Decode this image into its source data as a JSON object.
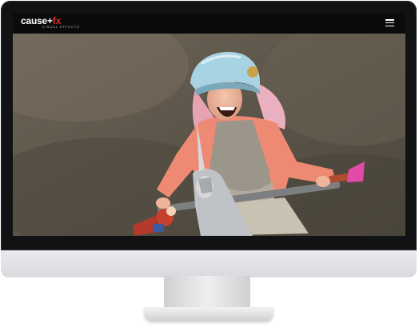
{
  "navbar": {
    "logo_main": "cause+",
    "logo_fx": "fx",
    "logo_sub": "VISUAL EFFECTS",
    "menu_icon": "hamburger-menu-icon"
  },
  "hero": {
    "image": "woman-in-helmet-riding-unicorn-bicycle-photo"
  },
  "colors": {
    "navbar_bg": "#0b0b0c",
    "logo_accent": "#e0242a",
    "bezel": "#111214"
  }
}
